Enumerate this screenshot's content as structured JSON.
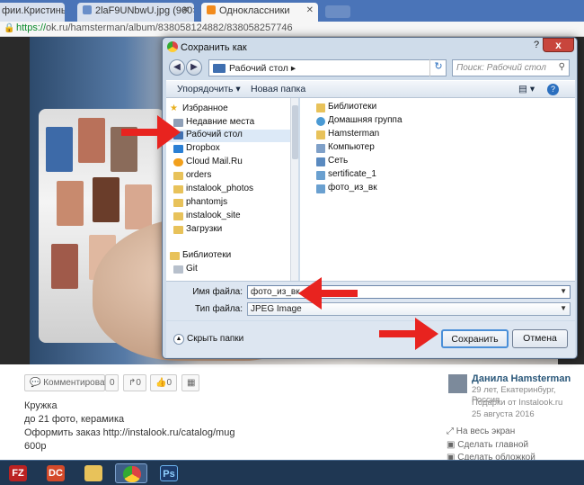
{
  "browser": {
    "tabs": [
      {
        "label": "фии.Кристины"
      },
      {
        "label": "2laF9UNbwU.jpg (960×7"
      },
      {
        "label": "Одноклассники"
      }
    ],
    "url_scheme": "https://",
    "url_rest": "ok.ru/hamsterman/album/838058124882/838058257746"
  },
  "post": {
    "actions": {
      "comment_label": "Комментировать",
      "comment_count": "0",
      "share_count": "0",
      "like_count": "0"
    },
    "description": [
      "Кружка",
      "до 21 фото, керамика",
      "Оформить заказ http://instalook.ru/catalog/mug",
      "600р"
    ],
    "author": {
      "name": "Данила Hamsterman",
      "meta": [
        "29 лет, Екатеринбург, Россия",
        "Подарки от Instalook.ru",
        "25 августа 2016"
      ]
    },
    "side_links": [
      "На весь экран",
      "Сделать главной",
      "Сделать обложкой"
    ]
  },
  "dialog": {
    "title": "Сохранить как",
    "path_label": "Рабочий стол",
    "search_placeholder": "Поиск: Рабочий стол",
    "organize_label": "Упорядочить",
    "new_folder_label": "Новая папка",
    "help": "?",
    "close": "x",
    "nav_tree": {
      "favorites_label": "Избранное",
      "items": [
        "Недавние места",
        "Рабочий стол",
        "Dropbox",
        "Cloud Mail.Ru",
        "orders",
        "instalook_photos",
        "phantomjs",
        "instalook_site",
        "Загрузки"
      ],
      "libraries_label": "Библиотеки",
      "library_items": [
        "Git"
      ]
    },
    "files": [
      "Библиотеки",
      "Домашняя группа",
      "Hamsterman",
      "Компьютер",
      "Сеть",
      "sertificate_1",
      "фото_из_вк"
    ],
    "filename_label": "Имя файла:",
    "filename_value": "фото_из_вк",
    "filetype_label": "Тип файла:",
    "filetype_value": "JPEG Image",
    "hide_folders_label": "Скрыть папки",
    "save_label": "Сохранить",
    "cancel_label": "Отмена"
  },
  "colors": {
    "arrow": "#e8231f",
    "taskbar": "#1f3753",
    "dialog_frame": "#cfdcea"
  },
  "taskbar_icons": [
    "filezilla-icon",
    "dreamweaver-icon",
    "explorer-icon",
    "chrome-icon",
    "photoshop-icon"
  ]
}
